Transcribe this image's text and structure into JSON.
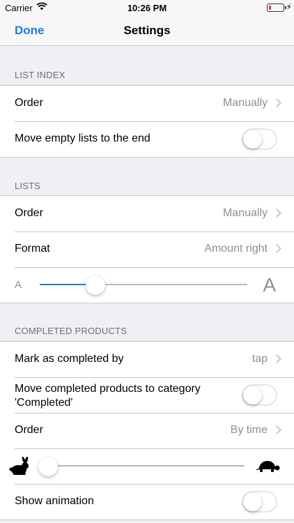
{
  "status_bar": {
    "carrier": "Carrier",
    "time": "10:26 PM"
  },
  "nav": {
    "done_label": "Done",
    "title": "Settings"
  },
  "list_index": {
    "header": "LIST INDEX",
    "order": {
      "label": "Order",
      "value": "Manually"
    },
    "move_empty": {
      "label": "Move empty lists to the end",
      "on": false
    }
  },
  "lists": {
    "header": "LISTS",
    "order": {
      "label": "Order",
      "value": "Manually"
    },
    "format": {
      "label": "Format",
      "value": "Amount right"
    },
    "font_size": {
      "small_label": "A",
      "large_label": "A",
      "level": 0.27
    }
  },
  "completed": {
    "header": "COMPLETED PRODUCTS",
    "mark_by": {
      "label": "Mark as completed by",
      "value": "tap"
    },
    "move_to_category": {
      "label": "Move completed products to category 'Completed'",
      "on": false
    },
    "order": {
      "label": "Order",
      "value": "By time"
    },
    "speed": {
      "level": 0.0
    },
    "show_animation": {
      "label": "Show animation",
      "on": false
    }
  },
  "colors": {
    "accent": "#1a7de0",
    "background": "#efeff4",
    "separator": "#c8c7cc",
    "secondary_text": "#8e8e93"
  },
  "icons": {
    "wifi": "wifi-icon",
    "battery": "battery-icon",
    "chevron": "chevron-right-icon",
    "rabbit": "rabbit-icon",
    "turtle": "turtle-icon"
  }
}
